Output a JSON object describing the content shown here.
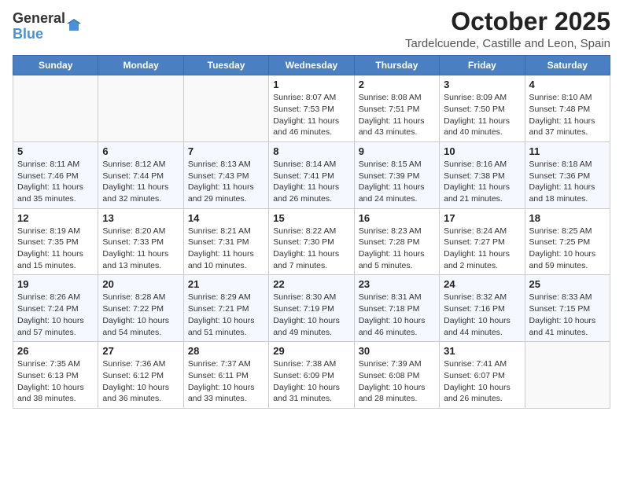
{
  "logo": {
    "general": "General",
    "blue": "Blue"
  },
  "header": {
    "title": "October 2025",
    "location": "Tardelcuende, Castille and Leon, Spain"
  },
  "days": [
    "Sunday",
    "Monday",
    "Tuesday",
    "Wednesday",
    "Thursday",
    "Friday",
    "Saturday"
  ],
  "weeks": [
    [
      {
        "day": "",
        "info": ""
      },
      {
        "day": "",
        "info": ""
      },
      {
        "day": "",
        "info": ""
      },
      {
        "day": "1",
        "info": "Sunrise: 8:07 AM\nSunset: 7:53 PM\nDaylight: 11 hours and 46 minutes."
      },
      {
        "day": "2",
        "info": "Sunrise: 8:08 AM\nSunset: 7:51 PM\nDaylight: 11 hours and 43 minutes."
      },
      {
        "day": "3",
        "info": "Sunrise: 8:09 AM\nSunset: 7:50 PM\nDaylight: 11 hours and 40 minutes."
      },
      {
        "day": "4",
        "info": "Sunrise: 8:10 AM\nSunset: 7:48 PM\nDaylight: 11 hours and 37 minutes."
      }
    ],
    [
      {
        "day": "5",
        "info": "Sunrise: 8:11 AM\nSunset: 7:46 PM\nDaylight: 11 hours and 35 minutes."
      },
      {
        "day": "6",
        "info": "Sunrise: 8:12 AM\nSunset: 7:44 PM\nDaylight: 11 hours and 32 minutes."
      },
      {
        "day": "7",
        "info": "Sunrise: 8:13 AM\nSunset: 7:43 PM\nDaylight: 11 hours and 29 minutes."
      },
      {
        "day": "8",
        "info": "Sunrise: 8:14 AM\nSunset: 7:41 PM\nDaylight: 11 hours and 26 minutes."
      },
      {
        "day": "9",
        "info": "Sunrise: 8:15 AM\nSunset: 7:39 PM\nDaylight: 11 hours and 24 minutes."
      },
      {
        "day": "10",
        "info": "Sunrise: 8:16 AM\nSunset: 7:38 PM\nDaylight: 11 hours and 21 minutes."
      },
      {
        "day": "11",
        "info": "Sunrise: 8:18 AM\nSunset: 7:36 PM\nDaylight: 11 hours and 18 minutes."
      }
    ],
    [
      {
        "day": "12",
        "info": "Sunrise: 8:19 AM\nSunset: 7:35 PM\nDaylight: 11 hours and 15 minutes."
      },
      {
        "day": "13",
        "info": "Sunrise: 8:20 AM\nSunset: 7:33 PM\nDaylight: 11 hours and 13 minutes."
      },
      {
        "day": "14",
        "info": "Sunrise: 8:21 AM\nSunset: 7:31 PM\nDaylight: 11 hours and 10 minutes."
      },
      {
        "day": "15",
        "info": "Sunrise: 8:22 AM\nSunset: 7:30 PM\nDaylight: 11 hours and 7 minutes."
      },
      {
        "day": "16",
        "info": "Sunrise: 8:23 AM\nSunset: 7:28 PM\nDaylight: 11 hours and 5 minutes."
      },
      {
        "day": "17",
        "info": "Sunrise: 8:24 AM\nSunset: 7:27 PM\nDaylight: 11 hours and 2 minutes."
      },
      {
        "day": "18",
        "info": "Sunrise: 8:25 AM\nSunset: 7:25 PM\nDaylight: 10 hours and 59 minutes."
      }
    ],
    [
      {
        "day": "19",
        "info": "Sunrise: 8:26 AM\nSunset: 7:24 PM\nDaylight: 10 hours and 57 minutes."
      },
      {
        "day": "20",
        "info": "Sunrise: 8:28 AM\nSunset: 7:22 PM\nDaylight: 10 hours and 54 minutes."
      },
      {
        "day": "21",
        "info": "Sunrise: 8:29 AM\nSunset: 7:21 PM\nDaylight: 10 hours and 51 minutes."
      },
      {
        "day": "22",
        "info": "Sunrise: 8:30 AM\nSunset: 7:19 PM\nDaylight: 10 hours and 49 minutes."
      },
      {
        "day": "23",
        "info": "Sunrise: 8:31 AM\nSunset: 7:18 PM\nDaylight: 10 hours and 46 minutes."
      },
      {
        "day": "24",
        "info": "Sunrise: 8:32 AM\nSunset: 7:16 PM\nDaylight: 10 hours and 44 minutes."
      },
      {
        "day": "25",
        "info": "Sunrise: 8:33 AM\nSunset: 7:15 PM\nDaylight: 10 hours and 41 minutes."
      }
    ],
    [
      {
        "day": "26",
        "info": "Sunrise: 7:35 AM\nSunset: 6:13 PM\nDaylight: 10 hours and 38 minutes."
      },
      {
        "day": "27",
        "info": "Sunrise: 7:36 AM\nSunset: 6:12 PM\nDaylight: 10 hours and 36 minutes."
      },
      {
        "day": "28",
        "info": "Sunrise: 7:37 AM\nSunset: 6:11 PM\nDaylight: 10 hours and 33 minutes."
      },
      {
        "day": "29",
        "info": "Sunrise: 7:38 AM\nSunset: 6:09 PM\nDaylight: 10 hours and 31 minutes."
      },
      {
        "day": "30",
        "info": "Sunrise: 7:39 AM\nSunset: 6:08 PM\nDaylight: 10 hours and 28 minutes."
      },
      {
        "day": "31",
        "info": "Sunrise: 7:41 AM\nSunset: 6:07 PM\nDaylight: 10 hours and 26 minutes."
      },
      {
        "day": "",
        "info": ""
      }
    ]
  ]
}
